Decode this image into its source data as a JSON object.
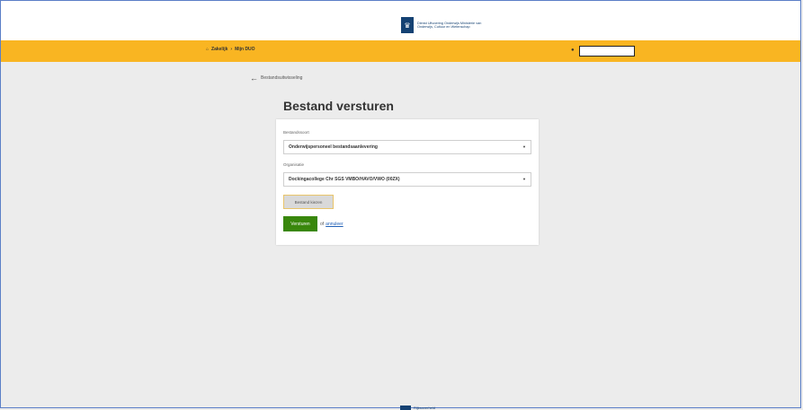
{
  "header": {
    "logo_text": "Dienst Uitvoering Onderwijs Ministerie van Onderwijs, Cultuur en Wetenschap"
  },
  "nav": {
    "home_icon": "home-icon",
    "crumb_business": "Zakelijk",
    "crumb_separator": "›",
    "crumb_mine": "Mijn DUO",
    "user_icon": "person-icon"
  },
  "back": {
    "arrow": "←",
    "label": "Bestandsuitwisseling"
  },
  "page": {
    "title": "Bestand versturen"
  },
  "form": {
    "file_type_label": "Bestandssoort",
    "file_type_value": "Onderwijspersoneel bestandsaanlevering",
    "org_label": "Organisatie",
    "org_value": "Dockingacollege Chr SGS VMBO/HAVO/VWO (00ZX)",
    "choose_file_label": "Bestand kiezen",
    "send_label": "Versturen",
    "or_text": "of",
    "cancel_label": "annuleer"
  },
  "footer": {
    "text": "Rijksoverheid"
  },
  "colors": {
    "navbar": "#f9b522",
    "send_button": "#39870c",
    "brand": "#154273",
    "link": "#1f5fb6"
  }
}
